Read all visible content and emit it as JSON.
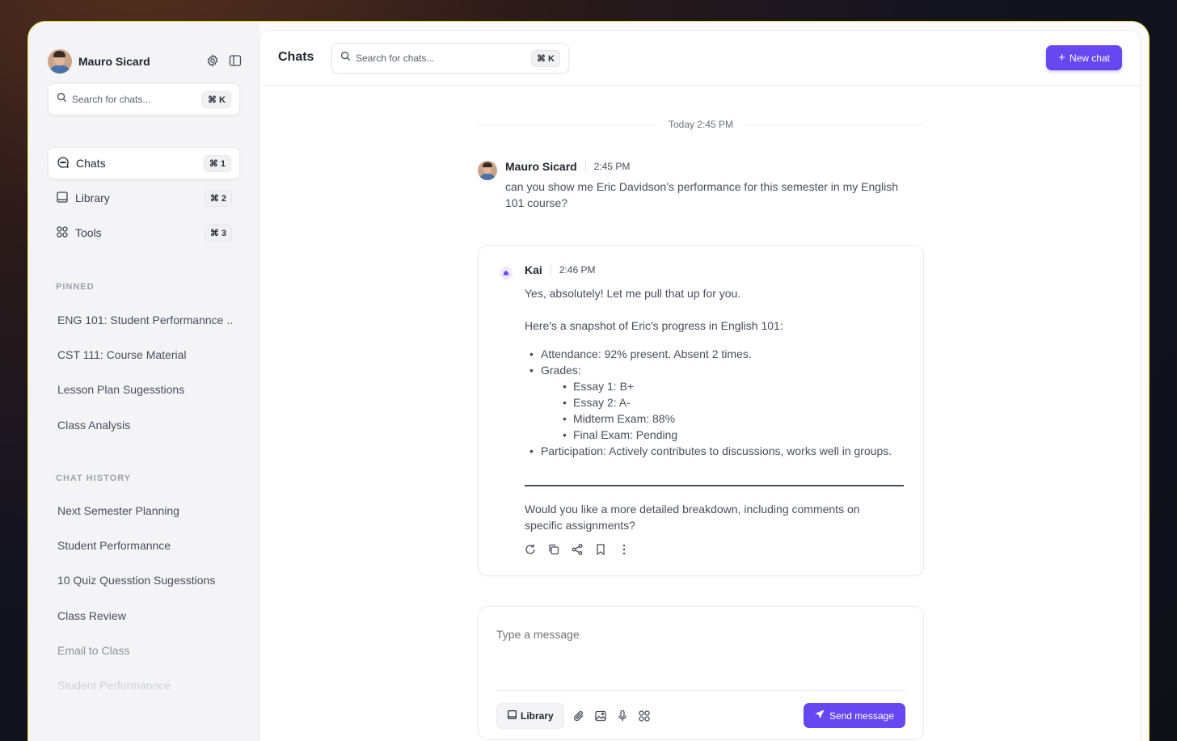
{
  "sidebar": {
    "user_name": "Mauro Sicard",
    "search": {
      "placeholder": "Search for chats...",
      "shortcut": "⌘ K"
    },
    "nav": [
      {
        "label": "Chats",
        "shortcut": "⌘ 1"
      },
      {
        "label": "Library",
        "shortcut": "⌘ 2"
      },
      {
        "label": "Tools",
        "shortcut": "⌘ 3"
      }
    ],
    "pinned_label": "PINNED",
    "pinned": [
      "ENG 101: Student Performannce ..",
      "CST 111: Course Material",
      "Lesson Plan Sugesstions",
      "Class Analysis"
    ],
    "history_label": "CHAT HISTORY",
    "history": [
      "Next Semester Planning",
      "Student Performannce",
      "10 Quiz Quesstion Sugesstions",
      "Class Review",
      "Email to Class",
      "Student Performannce"
    ]
  },
  "header": {
    "title": "Chats",
    "search": {
      "placeholder": "Search for chats...",
      "shortcut": "⌘ K"
    },
    "new_chat_label": "New chat"
  },
  "conversation": {
    "divider": "Today 2:45 PM",
    "user_message": {
      "name": "Mauro Sicard",
      "time": "2:45 PM",
      "text": "can you show me Eric Davidson’s performance for this semester in my English 101 course?"
    },
    "ai_message": {
      "name": "Kai",
      "time": "2:46 PM",
      "intro": "Yes, absolutely! Let me pull that up for you.",
      "lead": "Here's a snapshot of Eric's progress in English 101:",
      "attendance": "Attendance: 92% present. Absent 2 times.",
      "grades_label": "Grades:",
      "grades": [
        "Essay 1: B+",
        "Essay 2: A-",
        "Midterm Exam: 88%",
        "Final Exam: Pending"
      ],
      "participation": "Participation: Actively contributes to discussions, works well in groups.",
      "followup": "Would you like a more detailed breakdown, including comments on specific assignments?"
    }
  },
  "composer": {
    "placeholder": "Type a message",
    "library_label": "Library",
    "send_label": "Send message"
  },
  "colors": {
    "accent": "#6748f0",
    "frame_border": "#e6e245"
  }
}
